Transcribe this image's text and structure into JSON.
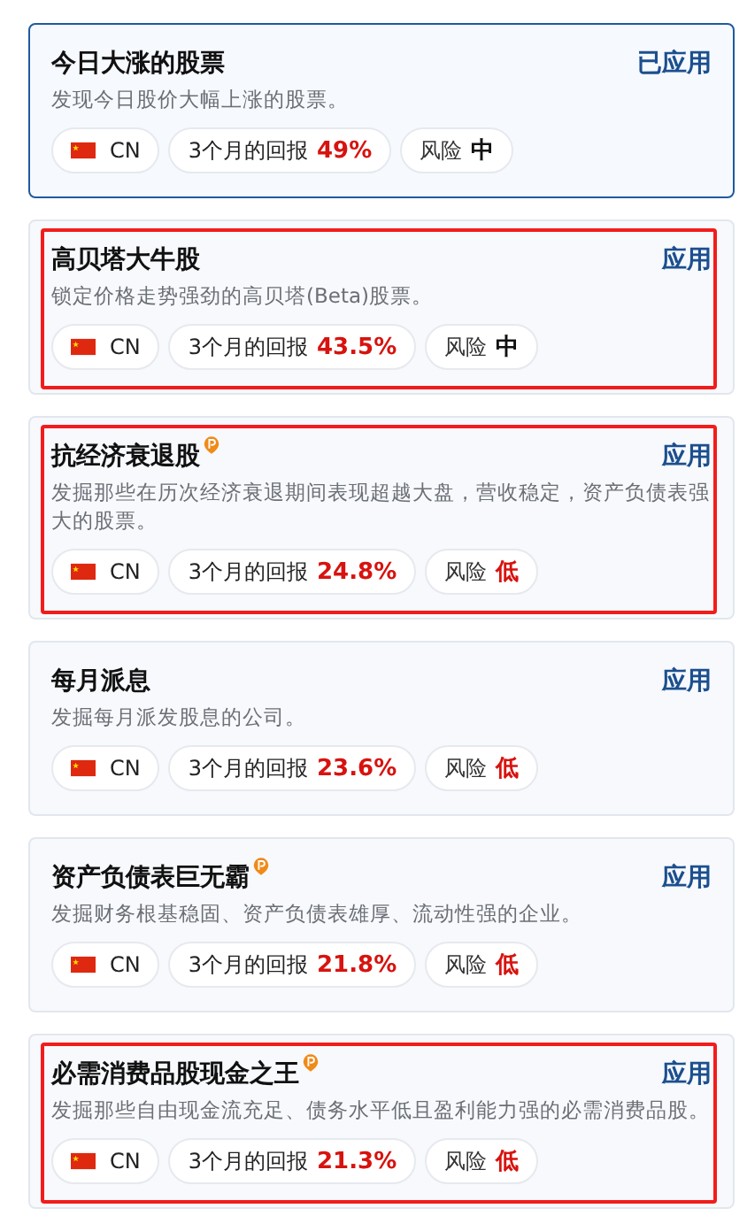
{
  "cards": [
    {
      "title": "今日大涨的股票",
      "premium": false,
      "selected": true,
      "highlighted": false,
      "action": "已应用",
      "description": "发现今日股价大幅上涨的股票。",
      "market": "CN",
      "return_label": "3个月的回报",
      "return_value": "49%",
      "risk": {
        "label": "风险",
        "value": "中",
        "kind": "medium"
      }
    },
    {
      "title": "高贝塔大牛股",
      "premium": false,
      "selected": false,
      "highlighted": true,
      "action": "应用",
      "description": "锁定价格走势强劲的高贝塔(Beta)股票。",
      "market": "CN",
      "return_label": "3个月的回报",
      "return_value": "43.5%",
      "risk": {
        "label": "风险",
        "value": "中",
        "kind": "medium"
      }
    },
    {
      "title": "抗经济衰退股",
      "premium": true,
      "selected": false,
      "highlighted": true,
      "action": "应用",
      "description": "发掘那些在历次经济衰退期间表现超越大盘，营收稳定，资产负债表强大的股票。",
      "market": "CN",
      "return_label": "3个月的回报",
      "return_value": "24.8%",
      "risk": {
        "label": "风险",
        "value": "低",
        "kind": "low"
      }
    },
    {
      "title": "每月派息",
      "premium": false,
      "selected": false,
      "highlighted": false,
      "action": "应用",
      "description": "发掘每月派发股息的公司。",
      "market": "CN",
      "return_label": "3个月的回报",
      "return_value": "23.6%",
      "risk": {
        "label": "风险",
        "value": "低",
        "kind": "low"
      }
    },
    {
      "title": "资产负债表巨无霸",
      "premium": true,
      "selected": false,
      "highlighted": false,
      "action": "应用",
      "description": "发掘财务根基稳固、资产负债表雄厚、流动性强的企业。",
      "market": "CN",
      "return_label": "3个月的回报",
      "return_value": "21.8%",
      "risk": {
        "label": "风险",
        "value": "低",
        "kind": "low"
      }
    },
    {
      "title": "必需消费品股现金之王",
      "premium": true,
      "selected": false,
      "highlighted": true,
      "action": "应用",
      "description": "发掘那些自由现金流充足、债务水平低且盈利能力强的必需消费品股。",
      "market": "CN",
      "return_label": "3个月的回报",
      "return_value": "21.3%",
      "risk": {
        "label": "风险",
        "value": "低",
        "kind": "low"
      }
    }
  ]
}
